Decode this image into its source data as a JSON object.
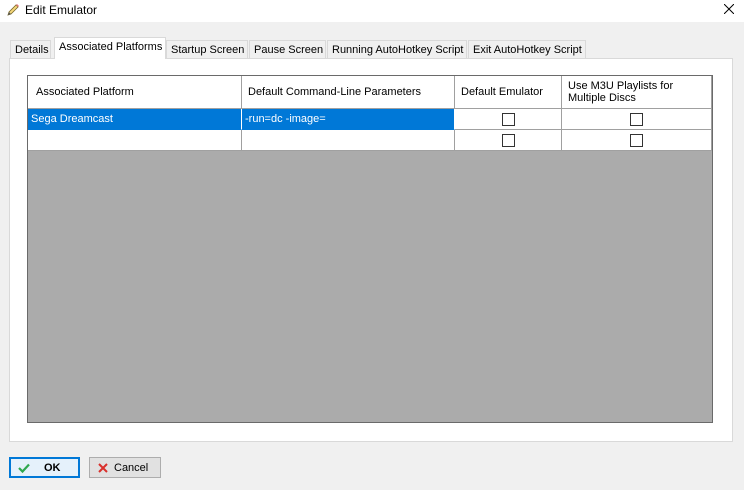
{
  "window": {
    "title": "Edit Emulator",
    "icon": "pencil-icon",
    "close_icon": "close-icon"
  },
  "tabs": [
    {
      "label": "Details",
      "active": false
    },
    {
      "label": "Associated Platforms",
      "active": true
    },
    {
      "label": "Startup Screen",
      "active": false
    },
    {
      "label": "Pause Screen",
      "active": false
    },
    {
      "label": "Running AutoHotkey Script",
      "active": false
    },
    {
      "label": "Exit AutoHotkey Script",
      "active": false
    }
  ],
  "grid": {
    "columns": [
      "Associated Platform",
      "Default Command-Line Parameters",
      "Default Emulator",
      "Use M3U Playlists for Multiple Discs"
    ],
    "rows": [
      {
        "platform": "Sega Dreamcast",
        "parameters": "-run=dc -image=",
        "default_emulator": false,
        "use_m3u": false,
        "selected": true
      },
      {
        "platform": "",
        "parameters": "",
        "default_emulator": false,
        "use_m3u": false,
        "selected": false
      }
    ]
  },
  "buttons": {
    "ok_label": "OK",
    "ok_icon": "checkmark-icon",
    "cancel_label": "Cancel",
    "cancel_icon": "x-icon"
  },
  "colors": {
    "selection": "#0078d7",
    "grid_background": "#ababab",
    "ok_icon": "#2fa84f",
    "cancel_icon": "#d9302c"
  }
}
